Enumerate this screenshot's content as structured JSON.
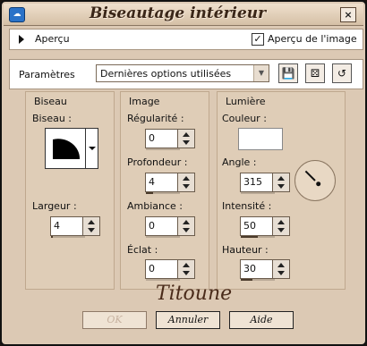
{
  "window": {
    "title": "Biseautage intérieur",
    "app_icon": "paintshop-icon",
    "close": "×"
  },
  "preview": {
    "label": "Aperçu",
    "image_preview_label": "Aperçu de l'image",
    "image_preview_checked": true
  },
  "settings": {
    "label": "Paramètres",
    "preset_value": "Dernières options utilisées",
    "tools": [
      "save-preset-icon",
      "random-icon",
      "reset-icon"
    ]
  },
  "groups": {
    "biseau": {
      "title": "Biseau",
      "shape_label": "Biseau :",
      "width_label": "Largeur :",
      "width_value": "4",
      "width_fraction": 0.04
    },
    "image": {
      "title": "Image",
      "regularity_label": "Régularité :",
      "regularity_value": "0",
      "regularity_fraction": 0.0,
      "depth_label": "Profondeur :",
      "depth_value": "4",
      "depth_fraction": 0.2,
      "ambience_label": "Ambiance :",
      "ambience_value": "0",
      "ambience_fraction": 0.0,
      "shine_label": "Éclat :",
      "shine_value": "0",
      "shine_fraction": 0.0
    },
    "light": {
      "title": "Lumière",
      "color_label": "Couleur :",
      "color_value": "#ffffff",
      "angle_label": "Angle :",
      "angle_value": "315",
      "angle_degrees": 315,
      "intensity_label": "Intensité :",
      "intensity_value": "50",
      "intensity_fraction": 0.5,
      "height_label": "Hauteur :",
      "height_value": "30",
      "height_fraction": 0.33
    }
  },
  "watermark": "Titoune",
  "buttons": {
    "ok": "OK",
    "cancel": "Annuler",
    "help": "Aide"
  },
  "colors": {
    "background": "#dcc9b4",
    "title_text": "#3a2618"
  }
}
